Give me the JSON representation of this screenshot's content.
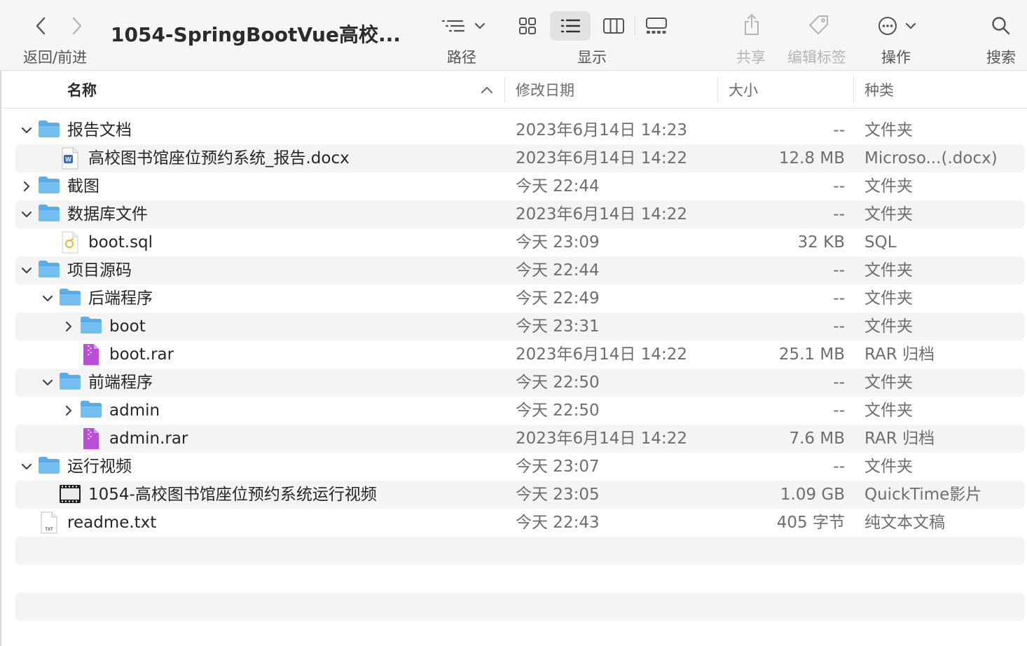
{
  "toolbar": {
    "nav_label": "返回/前进",
    "title": "1054-SpringBootVue高校...",
    "path_label": "路径",
    "view_label": "显示",
    "share_label": "共享",
    "tags_label": "编辑标签",
    "action_label": "操作",
    "search_label": "搜索"
  },
  "columns": {
    "name": "名称",
    "date": "修改日期",
    "size": "大小",
    "kind": "种类"
  },
  "rows": [
    {
      "name": "报告文档",
      "date": "2023年6月14日 14:23",
      "size": "--",
      "kind": "文件夹",
      "level": 0,
      "icon": "folder-icon",
      "disclosure": "expanded"
    },
    {
      "name": "高校图书馆座位预约系统_报告.docx",
      "date": "2023年6月14日 14:22",
      "size": "12.8 MB",
      "kind": "Microso...(.docx)",
      "level": 1,
      "icon": "word-doc-icon",
      "disclosure": "none"
    },
    {
      "name": "截图",
      "date": "今天 22:44",
      "size": "--",
      "kind": "文件夹",
      "level": 0,
      "icon": "folder-icon",
      "disclosure": "collapsed"
    },
    {
      "name": "数据库文件",
      "date": "2023年6月14日 14:22",
      "size": "--",
      "kind": "文件夹",
      "level": 0,
      "icon": "folder-icon",
      "disclosure": "expanded"
    },
    {
      "name": "boot.sql",
      "date": "今天 23:09",
      "size": "32 KB",
      "kind": "SQL",
      "level": 1,
      "icon": "sql-file-icon",
      "disclosure": "none"
    },
    {
      "name": "项目源码",
      "date": "今天 22:44",
      "size": "--",
      "kind": "文件夹",
      "level": 0,
      "icon": "folder-icon",
      "disclosure": "expanded"
    },
    {
      "name": "后端程序",
      "date": "今天 22:49",
      "size": "--",
      "kind": "文件夹",
      "level": 1,
      "icon": "folder-icon",
      "disclosure": "expanded"
    },
    {
      "name": "boot",
      "date": "今天 23:31",
      "size": "--",
      "kind": "文件夹",
      "level": 2,
      "icon": "folder-icon",
      "disclosure": "collapsed"
    },
    {
      "name": "boot.rar",
      "date": "2023年6月14日 14:22",
      "size": "25.1 MB",
      "kind": "RAR 归档",
      "level": 2,
      "icon": "rar-archive-icon",
      "disclosure": "none"
    },
    {
      "name": "前端程序",
      "date": "今天 22:50",
      "size": "--",
      "kind": "文件夹",
      "level": 1,
      "icon": "folder-icon",
      "disclosure": "expanded"
    },
    {
      "name": "admin",
      "date": "今天 22:50",
      "size": "--",
      "kind": "文件夹",
      "level": 2,
      "icon": "folder-icon",
      "disclosure": "collapsed"
    },
    {
      "name": "admin.rar",
      "date": "2023年6月14日 14:22",
      "size": "7.6 MB",
      "kind": "RAR 归档",
      "level": 2,
      "icon": "rar-archive-icon",
      "disclosure": "none"
    },
    {
      "name": "运行视频",
      "date": "今天 23:07",
      "size": "--",
      "kind": "文件夹",
      "level": 0,
      "icon": "folder-icon",
      "disclosure": "expanded"
    },
    {
      "name": "1054-高校图书馆座位预约系统运行视频",
      "date": "今天 23:05",
      "size": "1.09 GB",
      "kind": "QuickTime影片",
      "level": 1,
      "icon": "video-file-icon",
      "disclosure": "none"
    },
    {
      "name": "readme.txt",
      "date": "今天 22:43",
      "size": "405 字节",
      "kind": "纯文本文稿",
      "level": 0,
      "icon": "text-file-icon",
      "disclosure": "none"
    }
  ]
}
